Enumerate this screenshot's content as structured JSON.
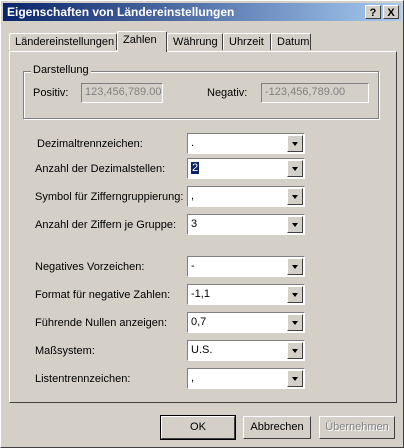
{
  "window": {
    "title": "Eigenschaften von Ländereinstellungen",
    "help_label": "?",
    "close_label": "X"
  },
  "tabs": [
    {
      "label": "Ländereinstellungen"
    },
    {
      "label": "Zahlen"
    },
    {
      "label": "Währung"
    },
    {
      "label": "Uhrzeit"
    },
    {
      "label": "Datum"
    }
  ],
  "preview": {
    "legend": "Darstellung",
    "positive_label": "Positiv:",
    "positive_value": "123,456,789.00",
    "negative_label": "Negativ:",
    "negative_value": "-123,456,789.00"
  },
  "settings": [
    {
      "label": "Dezimaltrennzeichen:",
      "value": "."
    },
    {
      "label": "Anzahl der Dezimalstellen:",
      "value": "2"
    },
    {
      "label": "Symbol für Zifferngruppierung:",
      "value": ","
    },
    {
      "label": "Anzahl der Ziffern je Gruppe:",
      "value": "3"
    },
    {
      "label": "Negatives Vorzeichen:",
      "value": "-"
    },
    {
      "label": "Format für negative Zahlen:",
      "value": "-1,1"
    },
    {
      "label": "Führende Nullen anzeigen:",
      "value": "0,7"
    },
    {
      "label": "Maßsystem:",
      "value": "U.S."
    },
    {
      "label": "Listentrennzeichen:",
      "value": ","
    }
  ],
  "buttons": {
    "ok": "OK",
    "cancel": "Abbrechen",
    "apply": "Übernehmen"
  },
  "colors": {
    "titlebar_start": "#0a246a",
    "titlebar_end": "#a6caf0",
    "face": "#d4d0c8",
    "selection": "#0a246a"
  }
}
